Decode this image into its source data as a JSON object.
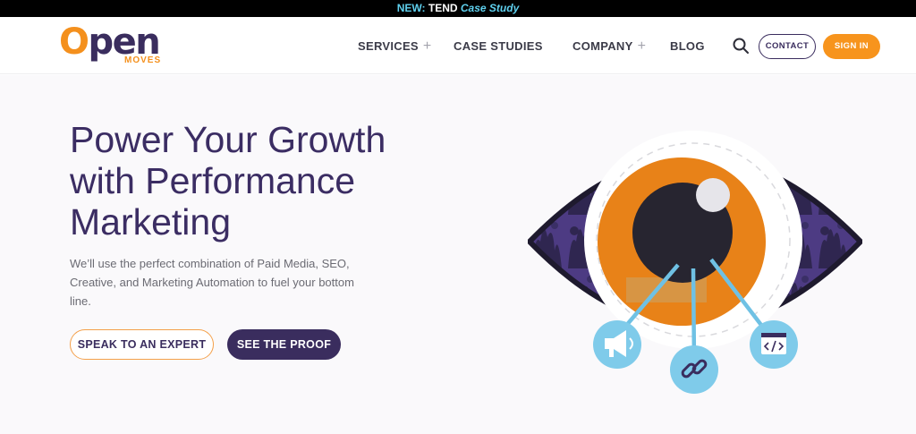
{
  "announcement": {
    "prefix": "NEW:",
    "brand": "TEND",
    "link": "Case Study"
  },
  "logo": {
    "word_o": "O",
    "word_rest": "pen",
    "tagline": "MOVES"
  },
  "nav": {
    "services": "SERVICES",
    "case_studies": "CASE STUDIES",
    "company": "COMPANY",
    "blog": "BLOG",
    "plus": "+",
    "contact": "CONTACT",
    "sign_in": "SIGN IN"
  },
  "hero": {
    "title_line1": "Power Your Growth",
    "title_line2": "with Performance",
    "title_line3": "Marketing",
    "subtitle_line1": "We’ll use the perfect combination of Paid Media, SEO,",
    "subtitle_line2": "Creative, and Marketing Automation to fuel your bottom line.",
    "cta_expert": "SPEAK TO AN EXPERT",
    "cta_proof": "SEE THE PROOF"
  },
  "illustration": {
    "icons": [
      "megaphone-icon",
      "link-icon",
      "code-window-icon"
    ]
  },
  "colors": {
    "brand_purple": "#3a2d5e",
    "brand_orange": "#f7941d",
    "accent_blue": "#5fd0ee",
    "icon_blue": "#7fcbea"
  }
}
